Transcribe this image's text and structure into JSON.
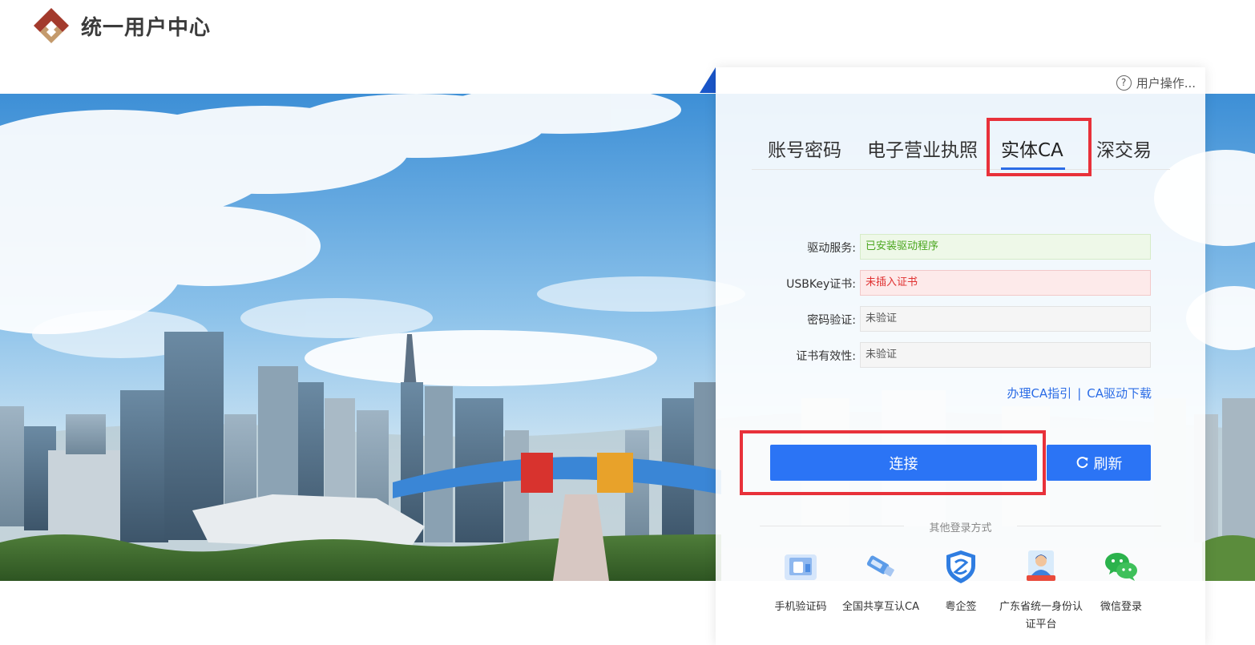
{
  "header": {
    "title": "统一用户中心"
  },
  "panel": {
    "help_label": "用户操作...",
    "tabs": [
      {
        "label": "账号密码",
        "active": false
      },
      {
        "label": "电子营业执照",
        "active": false
      },
      {
        "label": "实体CA",
        "active": true
      },
      {
        "label": "深交易",
        "active": false
      }
    ],
    "fields": [
      {
        "label": "驱动服务:",
        "value": "已安装驱动程序",
        "status": "ok"
      },
      {
        "label": "USBKey证书:",
        "value": "未插入证书",
        "status": "error"
      },
      {
        "label": "密码验证:",
        "value": "未验证",
        "status": "neutral"
      },
      {
        "label": "证书有效性:",
        "value": "未验证",
        "status": "neutral"
      }
    ],
    "links": {
      "guide": "办理CA指引",
      "separator": "|",
      "download": "CA驱动下载"
    },
    "connect_label": "连接",
    "refresh_label": "刷新",
    "other_title": "其他登录方式",
    "methods": [
      {
        "label": "手机验证码",
        "icon": "phone-code-icon"
      },
      {
        "label": "全国共享互认CA",
        "icon": "usb-key-icon"
      },
      {
        "label": "粤企签",
        "icon": "shield-sign-icon"
      },
      {
        "label": "广东省统一身份认证平台",
        "icon": "identity-person-icon"
      },
      {
        "label": "微信登录",
        "icon": "wechat-icon"
      }
    ]
  },
  "colors": {
    "accent": "#2b74f5",
    "highlight": "#e8313a",
    "ok": "#4aa61e",
    "error": "#e03131"
  }
}
